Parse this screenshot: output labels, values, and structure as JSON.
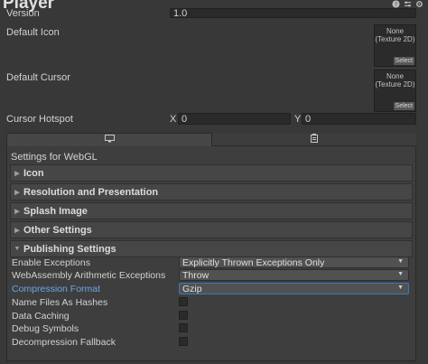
{
  "header": {
    "title": "Player",
    "icons": [
      "help-icon",
      "presets-icon",
      "settings-icon"
    ]
  },
  "top": {
    "version_label": "Version",
    "version_value": "1.0",
    "default_icon_label": "Default Icon",
    "default_cursor_label": "Default Cursor",
    "texture_none": "None",
    "texture_type": "(Texture 2D)",
    "select_label": "Select",
    "cursor_hotspot_label": "Cursor Hotspot",
    "x_label": "X",
    "x_value": "0",
    "y_label": "Y",
    "y_value": "0"
  },
  "tabs": [
    {
      "icon": "monitor-icon",
      "active": true
    },
    {
      "icon": "webgl-icon",
      "active": false
    }
  ],
  "settings_title": "Settings for WebGL",
  "sections": [
    "Icon",
    "Resolution and Presentation",
    "Splash Image",
    "Other Settings",
    "Publishing Settings"
  ],
  "publishing": {
    "enable_exceptions_label": "Enable Exceptions",
    "enable_exceptions_value": "Explicitly Thrown Exceptions Only",
    "wasm_arith_label": "WebAssembly Arithmetic Exceptions",
    "wasm_arith_value": "Throw",
    "compression_label": "Compression Format",
    "compression_value": "Gzip",
    "name_files_label": "Name Files As Hashes",
    "data_caching_label": "Data Caching",
    "debug_symbols_label": "Debug Symbols",
    "decompression_label": "Decompression Fallback"
  },
  "colors": {
    "accent_label": "#6aa7e6",
    "focus_border": "#3a79bb"
  }
}
